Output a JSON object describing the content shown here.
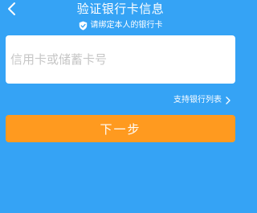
{
  "header": {
    "title": "验证银行卡信息",
    "back_icon": "chevron-left-icon"
  },
  "hint": {
    "icon": "shield-check-icon",
    "text": "请绑定本人的银行卡"
  },
  "card_form": {
    "card_number_placeholder": "信用卡或储蓄卡号",
    "card_number_value": ""
  },
  "supported_banks": {
    "label": "支持银行列表",
    "icon": "chevron-right-icon"
  },
  "actions": {
    "next_label": "下一步"
  },
  "colors": {
    "background": "#35a3f5",
    "card": "#ffffff",
    "button": "#ff9a1f",
    "placeholder": "#c6c6c6",
    "text_light": "#ffffff"
  }
}
